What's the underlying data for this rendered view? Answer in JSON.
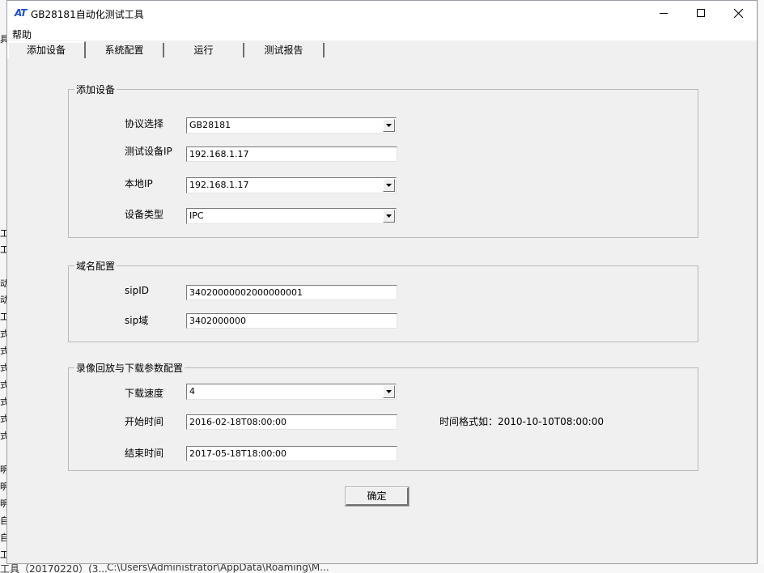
{
  "window": {
    "icon_text": "AT",
    "title": "GB28181自动化测试工具"
  },
  "menu": [
    "帮助"
  ],
  "tabs": [
    "添加设备",
    "系统配置",
    "运行",
    "测试报告"
  ],
  "add_device": {
    "legend": "添加设备",
    "protocol_label": "协议选择",
    "protocol_value": "GB28181",
    "test_ip_label": "测试设备IP",
    "test_ip_value": "192.168.1.17",
    "local_ip_label": "本地IP",
    "local_ip_value": "192.168.1.17",
    "device_type_label": "设备类型",
    "device_type_value": "IPC"
  },
  "domain_config": {
    "legend": "域名配置",
    "sip_id_label": "sipID",
    "sip_id_value": "34020000002000000001",
    "sip_domain_label": "sip域",
    "sip_domain_value": "3402000000"
  },
  "playback": {
    "legend": "录像回放与下载参数配置",
    "speed_label": "下载速度",
    "speed_value": "4",
    "start_label": "开始时间",
    "start_value": "2016-02-18T08:00:00",
    "end_label": "结束时间",
    "end_value": "2017-05-18T18:00:00",
    "format_hint": "时间格式如：2010-10-10T08:00:00"
  },
  "ok_button": "确定",
  "background": {
    "bottom_text_1": "工具（20170220）(3...",
    "bottom_text_2": "C:\\Users\\Administrator\\AppData\\Roaming\\M...",
    "left_fragments": [
      "具",
      "工",
      "工",
      "动",
      "动",
      "工",
      "式",
      "式",
      "式",
      "式",
      "式",
      "式",
      "式",
      "明",
      "明",
      "明",
      "自",
      "自",
      "工"
    ]
  }
}
